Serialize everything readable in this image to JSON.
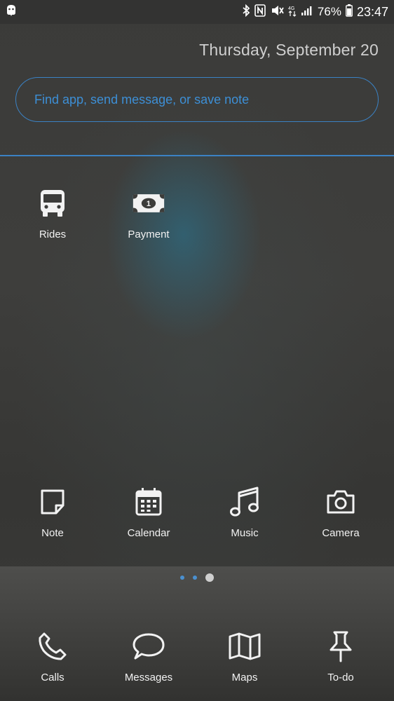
{
  "status_bar": {
    "battery_percent": "76%",
    "time": "23:47",
    "icons": [
      "notification-icon",
      "bluetooth-icon",
      "nfc-icon",
      "vibrate-icon",
      "lte-icon",
      "signal-icon",
      "battery-icon"
    ]
  },
  "header": {
    "date": "Thursday, September 20"
  },
  "search": {
    "placeholder": "Find app, send message, or save note"
  },
  "top_apps": [
    {
      "label": "Rides",
      "icon": "bus-icon"
    },
    {
      "label": "Payment",
      "icon": "payment-icon"
    }
  ],
  "middle_apps": [
    {
      "label": "Note",
      "icon": "note-icon"
    },
    {
      "label": "Calendar",
      "icon": "calendar-icon"
    },
    {
      "label": "Music",
      "icon": "music-icon"
    },
    {
      "label": "Camera",
      "icon": "camera-icon"
    }
  ],
  "page_indicator": {
    "pages": 3,
    "current": 3
  },
  "dock": [
    {
      "label": "Calls",
      "icon": "phone-icon"
    },
    {
      "label": "Messages",
      "icon": "message-icon"
    },
    {
      "label": "Maps",
      "icon": "map-icon"
    },
    {
      "label": "To-do",
      "icon": "pin-icon"
    }
  ],
  "colors": {
    "accent": "#3b82c4",
    "accent_text": "#3d8fd6"
  }
}
